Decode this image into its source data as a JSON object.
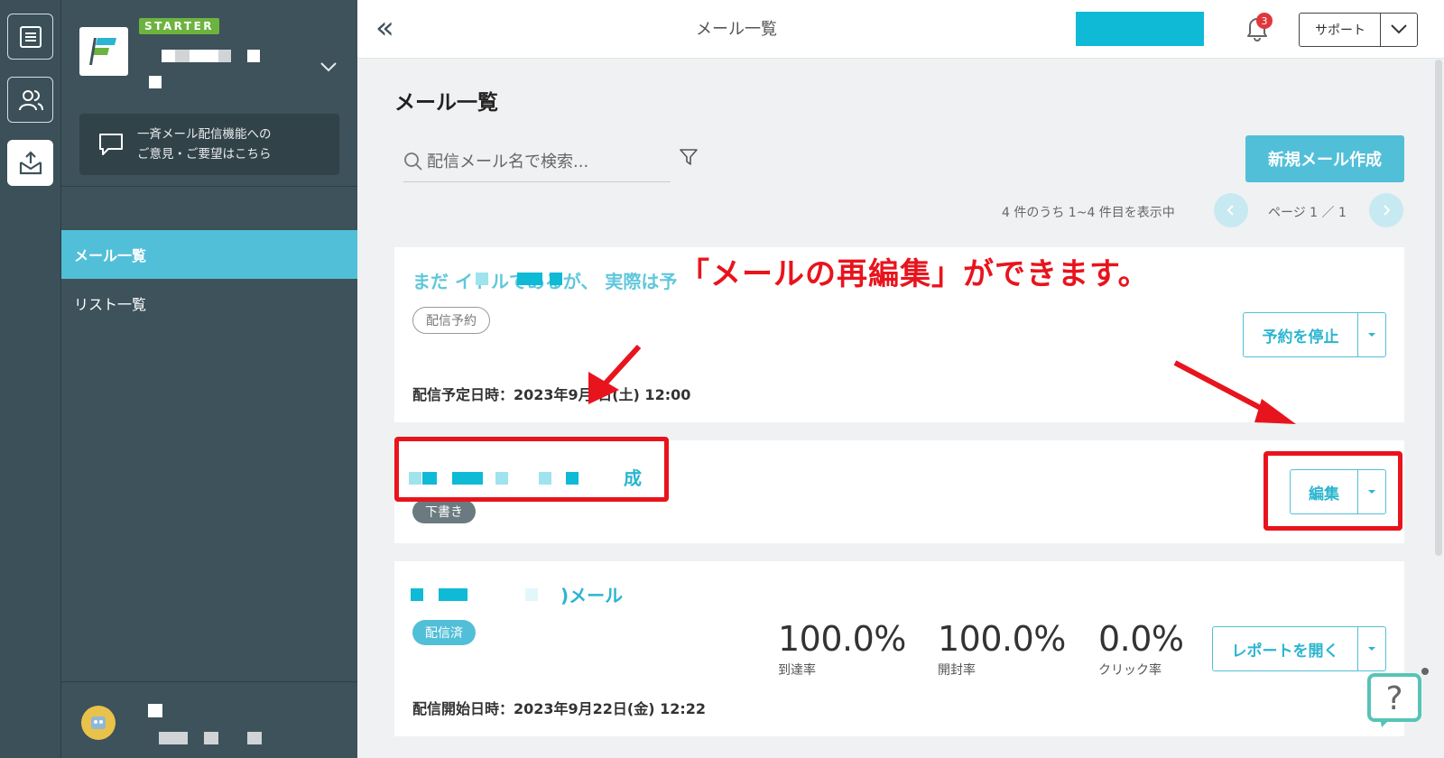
{
  "sidebar": {
    "plan_badge": "STARTER",
    "feedback_line1": "一斉メール配信機能への",
    "feedback_line2": "ご意見・ご要望はこちら",
    "nav": [
      {
        "label": "メール一覧",
        "active": true
      },
      {
        "label": "リスト一覧",
        "active": false
      }
    ]
  },
  "header": {
    "title": "メール一覧",
    "notification_count": "3",
    "support_label": "サポート"
  },
  "main": {
    "title": "メール一覧",
    "search_placeholder": "配信メール名で検索...",
    "new_button": "新規メール作成",
    "result_count": "4 件のうち 1~4 件目を表示中",
    "page_label": "ページ 1 ／ 1"
  },
  "cards": [
    {
      "title": "まだ     イトルであるが、 実際は予    ",
      "status": "配信予約",
      "date": "配信予定日時：2023年9月  日(土) 12:00",
      "action": "予約を停止"
    },
    {
      "title": "成",
      "status": "下書き",
      "action": "編集"
    },
    {
      "title": ")メール",
      "status": "配信済",
      "date": "配信開始日時：2023年9月22日(金) 12:22",
      "action": "レポートを開く",
      "stats": [
        {
          "value": "100.0%",
          "label": "到達率"
        },
        {
          "value": "100.0%",
          "label": "開封率"
        },
        {
          "value": "0.0%",
          "label": "クリック率"
        }
      ]
    }
  ],
  "annotation": {
    "text": "「メールの再編集」ができます。",
    "color": "#e8141d"
  },
  "colors": {
    "accent": "#52bfd8",
    "sidebar": "#3d525a"
  }
}
